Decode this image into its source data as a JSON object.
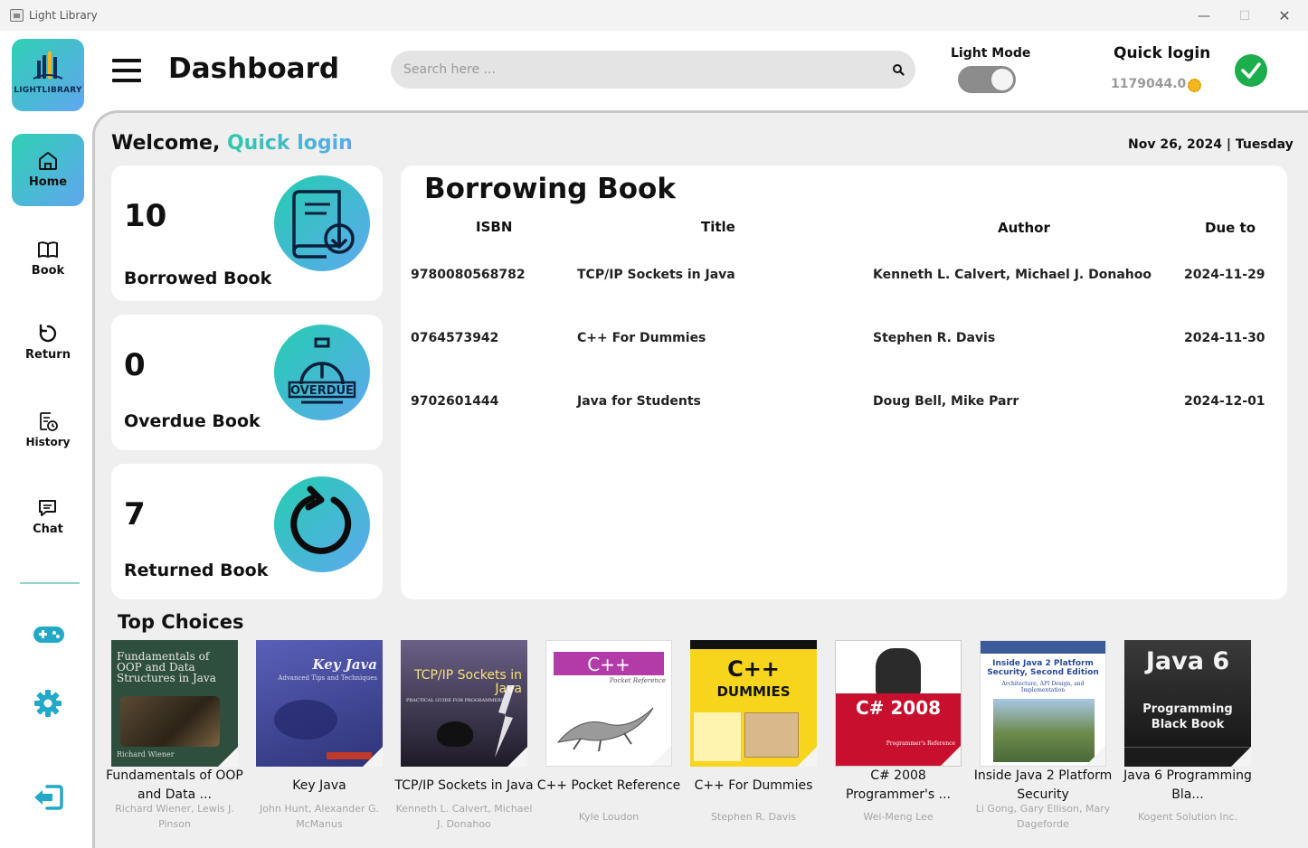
{
  "window": {
    "title": "Light Library",
    "minimize": "—",
    "maximize": "☐",
    "close": "✕"
  },
  "logo": {
    "text": "LIGHTLIBRARY"
  },
  "sidebar": {
    "items": [
      {
        "label": "Home",
        "icon": "home-icon"
      },
      {
        "label": "Book",
        "icon": "book-icon"
      },
      {
        "label": "Return",
        "icon": "return-icon"
      },
      {
        "label": "History",
        "icon": "history-icon"
      },
      {
        "label": "Chat",
        "icon": "chat-icon"
      }
    ],
    "extras": [
      "gamepad-icon",
      "settings-icon",
      "logout-icon"
    ]
  },
  "header": {
    "title": "Dashboard",
    "search_placeholder": "Search here ...",
    "mode_label": "Light Mode",
    "user_name": "Quick login",
    "balance": "1179044.0"
  },
  "welcome": {
    "prefix": "Welcome,",
    "name": "Quick login"
  },
  "date": "Nov 26, 2024 | Tuesday",
  "stats": {
    "borrowed": {
      "value": "10",
      "label": "Borrowed Book"
    },
    "overdue": {
      "value": "0",
      "label": "Overdue Book",
      "badge": "OVERDUE"
    },
    "returned": {
      "value": "7",
      "label": "Returned Book"
    }
  },
  "borrowing": {
    "title": "Borrowing Book",
    "columns": [
      "ISBN",
      "Title",
      "Author",
      "Due to"
    ],
    "rows": [
      [
        "9780080568782",
        "TCP/IP Sockets in Java",
        "Kenneth L. Calvert, Michael J. Donahoo",
        "2024-11-29"
      ],
      [
        "0764573942",
        "C++ For Dummies",
        "Stephen R. Davis",
        "2024-11-30"
      ],
      [
        "9702601444",
        "Java for Students",
        "Doug Bell, Mike Parr",
        "2024-12-01"
      ]
    ]
  },
  "top_choices": {
    "title": "Top Choices",
    "books": [
      {
        "title": "Fundamentals of OOP and Data ...",
        "author": "Richard Wiener, Lewis J. Pinson",
        "cover_text": "Fundamentals of OOP and Data Structures in Java",
        "cover_sub": "Richard Wiener",
        "cover_color": "#2f4f3e"
      },
      {
        "title": "Key Java",
        "author": "John Hunt, Alexander G. McManus",
        "cover_text": "Key Java",
        "cover_sub": "Advanced Tips and Techniques",
        "cover_color": "#4a4fa3"
      },
      {
        "title": "TCP/IP Sockets in Java",
        "author": "Kenneth L. Calvert, Michael J. Donahoo",
        "cover_text": "TCP/IP Sockets in Java",
        "cover_sub": "PRACTICAL GUIDE FOR PROGRAMMERS",
        "cover_color": "#3b3848"
      },
      {
        "title": "C++ Pocket Reference",
        "author": "Kyle Loudon",
        "cover_text": "C++",
        "cover_sub": "Pocket Reference",
        "cover_color": "#ffffff"
      },
      {
        "title": "C++ For Dummies",
        "author": "Stephen R. Davis",
        "cover_text": "C++",
        "cover_sub": "DUMMIES",
        "cover_color": "#f7d51d"
      },
      {
        "title": "C# 2008 Programmer's ...",
        "author": "Wei-Meng Lee",
        "cover_text": "C# 2008",
        "cover_sub": "Programmer's Reference",
        "cover_color": "#c8102e"
      },
      {
        "title": "Inside Java 2 Platform Security",
        "author": "Li Gong, Gary Ellison, Mary Dageforde",
        "cover_text": "Inside Java 2 Platform Security, Second Edition",
        "cover_sub": "Architecture, API Design, and Implementation",
        "cover_color": "#ffffff"
      },
      {
        "title": "Java 6 Programming Bla...",
        "author": "Kogent Solution Inc.",
        "cover_text": "Java 6",
        "cover_sub": "Programming Black Book",
        "cover_color": "#262626"
      }
    ]
  },
  "colors": {
    "accent_start": "#2ed0b4",
    "accent_end": "#61a6ef",
    "success": "#1cad4c"
  }
}
